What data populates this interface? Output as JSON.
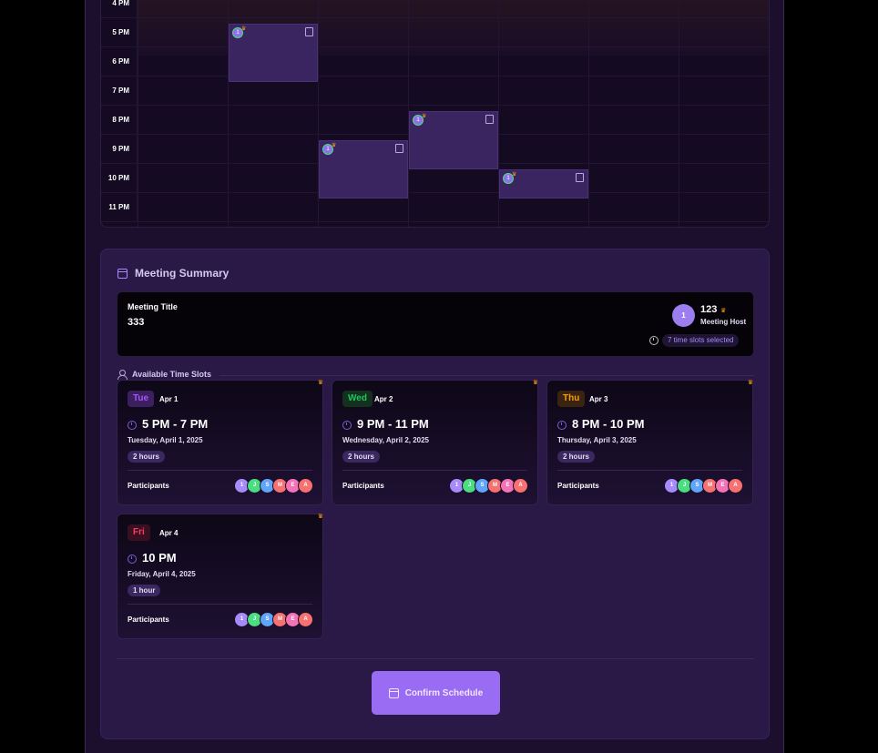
{
  "calendar": {
    "times": [
      "4 PM",
      "5 PM",
      "6 PM",
      "7 PM",
      "8 PM",
      "9 PM",
      "10 PM",
      "11 PM"
    ],
    "slots": [
      {
        "day": "Tue",
        "start": "5 PM",
        "end": "7 PM",
        "avatar": "1"
      },
      {
        "day": "Wed",
        "start": "9 PM",
        "end": "11 PM",
        "avatar": "1"
      },
      {
        "day": "Thu",
        "start": "8 PM",
        "end": "10 PM",
        "avatar": "1"
      },
      {
        "day": "Fri",
        "start": "10 PM",
        "end": "11 PM",
        "avatar": "1"
      }
    ]
  },
  "summary": {
    "title": "Meeting Summary",
    "meeting_title_label": "Meeting Title",
    "meeting_title_value": "333",
    "host_avatar": "1",
    "host_name": "123",
    "host_role": "Meeting Host",
    "slots_selected": "7 time slots selected",
    "available_label": "Available Time Slots",
    "participants_label": "Participants",
    "confirm_label": "Confirm Schedule"
  },
  "cards": [
    {
      "day": "Tue",
      "date_short": "Apr 1",
      "time": "5 PM - 7 PM",
      "date_long": "Tuesday, April 1, 2025",
      "duration": "2 hours",
      "day_color": "#a855f7",
      "day_bg": "#3b1f5e"
    },
    {
      "day": "Wed",
      "date_short": "Apr 2",
      "time": "9 PM - 11 PM",
      "date_long": "Wednesday, April 2, 2025",
      "duration": "2 hours",
      "day_color": "#22c55e",
      "day_bg": "#14301f"
    },
    {
      "day": "Thu",
      "date_short": "Apr 3",
      "time": "8 PM - 10 PM",
      "date_long": "Thursday, April 3, 2025",
      "duration": "2 hours",
      "day_color": "#f59e0b",
      "day_bg": "#3a2410"
    },
    {
      "day": "Fri",
      "date_short": "Apr 4",
      "time": "10 PM",
      "date_long": "Friday, April 4, 2025",
      "duration": "1 hour",
      "day_color": "#f43f5e",
      "day_bg": "#3a1020"
    }
  ],
  "participants": [
    {
      "initial": "1",
      "color": "#a78bfa"
    },
    {
      "initial": "J",
      "color": "#4ade80"
    },
    {
      "initial": "S",
      "color": "#60a5fa"
    },
    {
      "initial": "M",
      "color": "#f87171"
    },
    {
      "initial": "E",
      "color": "#f472b6"
    },
    {
      "initial": "A",
      "color": "#f87171"
    }
  ],
  "colors": {
    "accent": "#9a6cf3",
    "host_crown": "#f59e0b"
  }
}
